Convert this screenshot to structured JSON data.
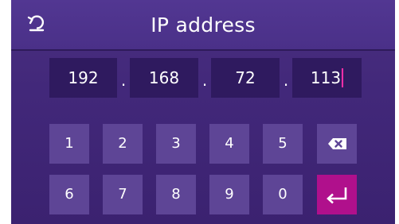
{
  "header": {
    "title": "IP address",
    "back_icon": "back-arrow-icon"
  },
  "ip": {
    "octets": [
      "192",
      "168",
      "72",
      "113"
    ],
    "separator": ".",
    "active_index": 3
  },
  "keypad": {
    "row1": [
      "1",
      "2",
      "3",
      "4",
      "5"
    ],
    "row2": [
      "6",
      "7",
      "8",
      "9",
      "0"
    ],
    "backspace_icon": "backspace-icon",
    "enter_icon": "enter-icon"
  },
  "colors": {
    "background": "#42287a",
    "key": "#5e4596",
    "field": "#2f1a5f",
    "enter": "#b0108c",
    "cursor": "#ff2fa8"
  }
}
